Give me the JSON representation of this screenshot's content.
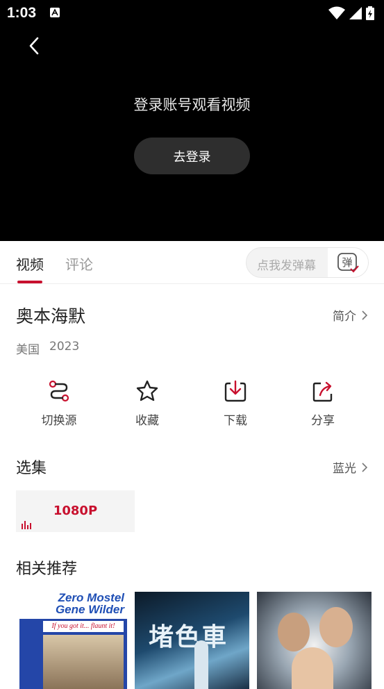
{
  "status": {
    "time": "1:03"
  },
  "player": {
    "login_prompt": "登录账号观看视频",
    "login_button": "去登录"
  },
  "tabs": {
    "video": "视频",
    "comment": "评论"
  },
  "danmu": {
    "placeholder": "点我发弹幕",
    "toggle_label": "弹"
  },
  "movie": {
    "title": "奥本海默",
    "intro_link": "简介",
    "country": "美国",
    "year": "2023"
  },
  "actions": [
    {
      "label": "切换源",
      "icon": "switch-source-icon"
    },
    {
      "label": "收藏",
      "icon": "star-icon"
    },
    {
      "label": "下载",
      "icon": "download-icon"
    },
    {
      "label": "分享",
      "icon": "share-icon"
    }
  ],
  "episodes": {
    "title": "选集",
    "quality": "蓝光",
    "items": [
      "1080P"
    ]
  },
  "recommend": {
    "title": "相关推荐",
    "posters": [
      {
        "line1": "Zero Mostel",
        "line2": "Gene Wilder",
        "tagline": "If you got it... flaunt it!"
      },
      {
        "big_text": "堵色車"
      },
      {}
    ]
  },
  "colors": {
    "accent": "#c8102e",
    "player_bg": "#000000"
  }
}
